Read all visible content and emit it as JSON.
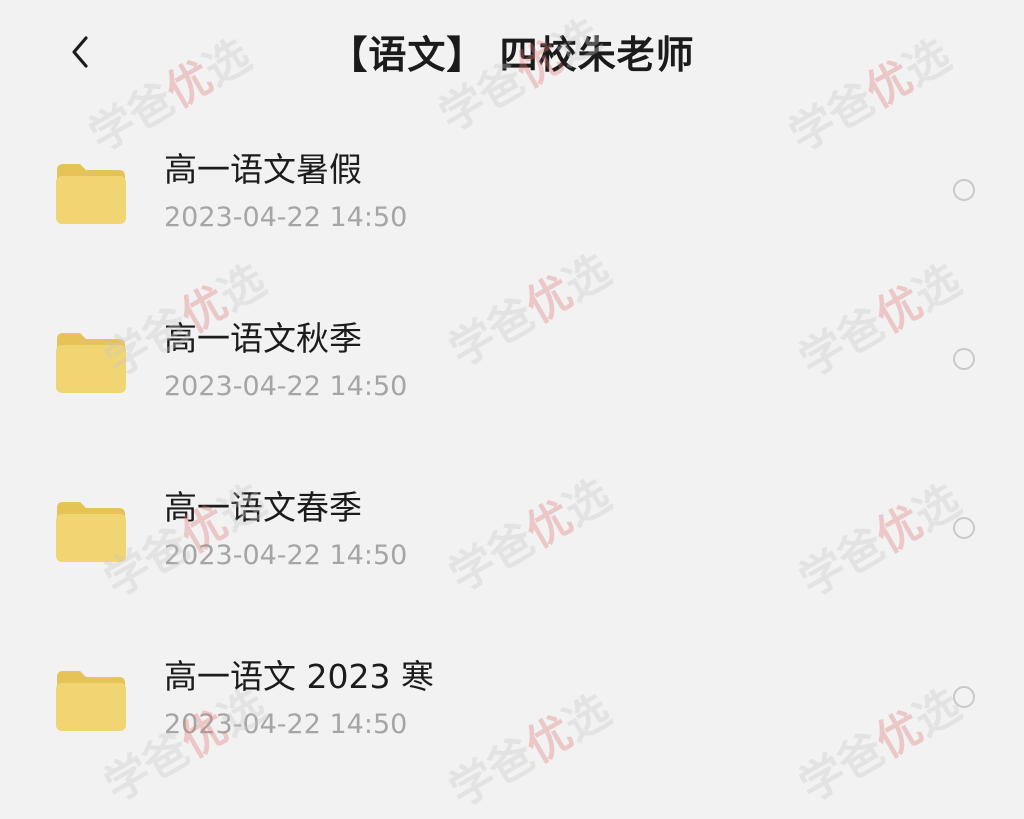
{
  "header": {
    "back_icon": "chevron-left-icon",
    "title": "【语文】 四校朱老师"
  },
  "folders": [
    {
      "name": "高一语文暑假",
      "date": "2023-04-22 14:50"
    },
    {
      "name": "高一语文秋季",
      "date": "2023-04-22 14:50"
    },
    {
      "name": "高一语文春季",
      "date": "2023-04-22 14:50"
    },
    {
      "name": "高一语文 2023 寒",
      "date": "2023-04-22 14:50"
    }
  ],
  "watermark": {
    "text_left": "学爸",
    "text_mid": "优",
    "text_right": "选"
  },
  "colors": {
    "folder": "#f1d572",
    "background": "#f2f2f2"
  }
}
